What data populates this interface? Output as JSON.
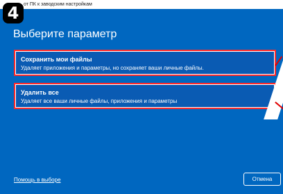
{
  "step_badge": "4",
  "window": {
    "title": "от ПК к заводским настройкам"
  },
  "dialog": {
    "heading": "Выберите параметр",
    "options": [
      {
        "title": "Сохранить мои файлы",
        "description": "Удаляет приложения и параметры, но сохраняет ваши личные файлы."
      },
      {
        "title": "Удалить все",
        "description": "Удаляет все ваши личные файлы, приложения и параметры"
      }
    ],
    "help_link": "Помощь в выборе",
    "cancel_label": "Отмена"
  },
  "colors": {
    "dialog_background": "#0067c0",
    "highlight_border": "#ff2a2a",
    "text": "#ffffff"
  }
}
